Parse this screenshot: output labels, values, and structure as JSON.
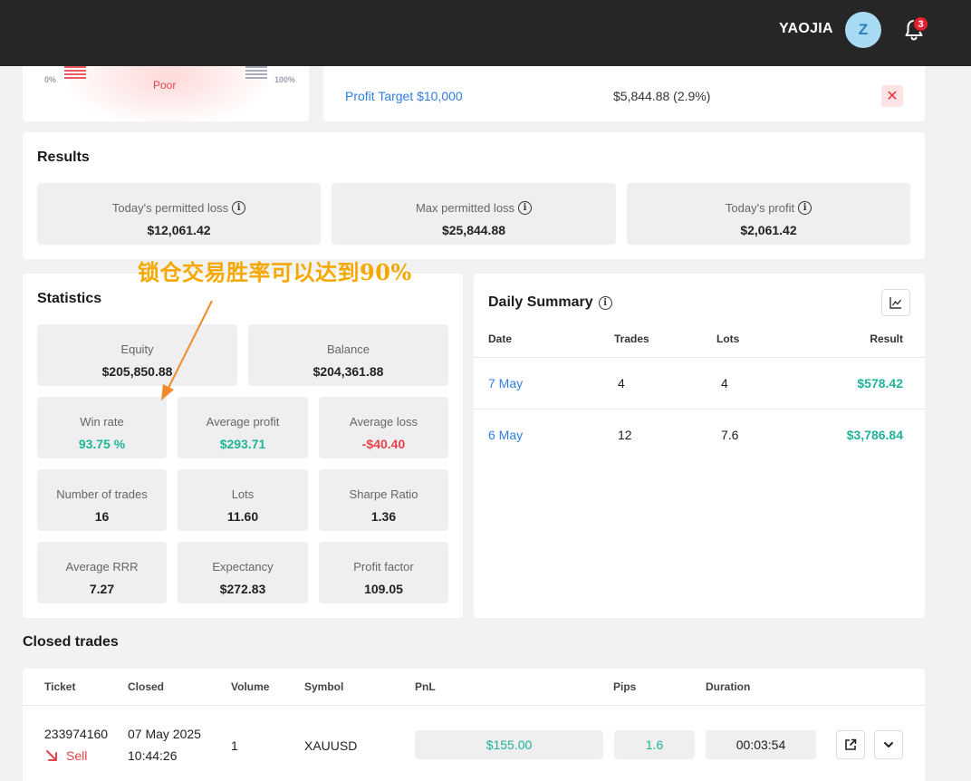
{
  "header": {
    "username": "YAOJIA",
    "avatar_letter": "Z",
    "notifications_count": "3"
  },
  "gauge": {
    "min_label": "0%",
    "max_label": "100%",
    "rating": "Poor"
  },
  "objective": {
    "label": "Profit Target $10,000",
    "value": "$5,844.88 (2.9%)",
    "status_symbol": "✕"
  },
  "results": {
    "title": "Results",
    "items": [
      {
        "label": "Today's permitted loss",
        "value": "$12,061.42"
      },
      {
        "label": "Max permitted loss",
        "value": "$25,844.88"
      },
      {
        "label": "Today's profit",
        "value": "$2,061.42"
      }
    ]
  },
  "annotation": {
    "text": "锁仓交易胜率可以达到90%"
  },
  "statistics": {
    "title": "Statistics",
    "equity": {
      "label": "Equity",
      "value": "$205,850.88"
    },
    "balance": {
      "label": "Balance",
      "value": "$204,361.88"
    },
    "grid": [
      {
        "label": "Win rate",
        "value": "93.75 %"
      },
      {
        "label": "Average profit",
        "value": "$293.71"
      },
      {
        "label": "Average loss",
        "value": "-$40.40"
      },
      {
        "label": "Number of trades",
        "value": "16"
      },
      {
        "label": "Lots",
        "value": "11.60"
      },
      {
        "label": "Sharpe Ratio",
        "value": "1.36"
      },
      {
        "label": "Average RRR",
        "value": "7.27"
      },
      {
        "label": "Expectancy",
        "value": "$272.83"
      },
      {
        "label": "Profit factor",
        "value": "109.05"
      }
    ]
  },
  "daily_summary": {
    "title": "Daily Summary",
    "columns": [
      "Date",
      "Trades",
      "Lots",
      "Result"
    ],
    "rows": [
      {
        "date": "7 May",
        "trades": "4",
        "lots": "4",
        "result": "$578.42"
      },
      {
        "date": "6 May",
        "trades": "12",
        "lots": "7.6",
        "result": "$3,786.84"
      }
    ]
  },
  "closed_trades": {
    "title": "Closed trades",
    "columns": [
      "Ticket",
      "Closed",
      "Volume",
      "Symbol",
      "PnL",
      "Pips",
      "Duration"
    ],
    "rows": [
      {
        "ticket": "233974160",
        "side": "Sell",
        "closed_date": "07 May 2025",
        "closed_time": "10:44:26",
        "volume": "1",
        "symbol": "XAUUSD",
        "pnl": "$155.00",
        "pips": "1.6",
        "duration": "00:03:54"
      }
    ]
  },
  "colors": {
    "positive": "#1fb39a",
    "negative": "#e8424a",
    "link": "#2f7fe0",
    "annotation": "#f5a800"
  }
}
